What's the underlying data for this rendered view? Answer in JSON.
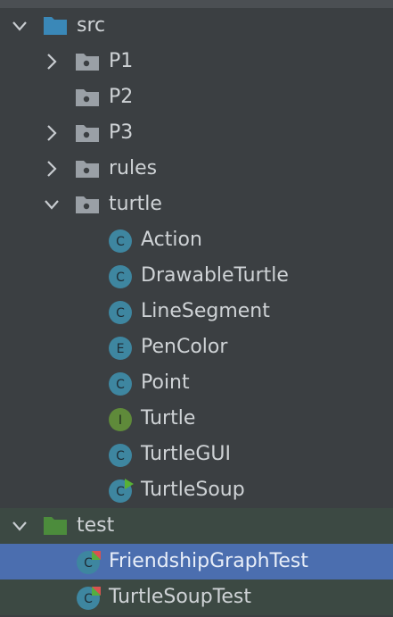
{
  "tree": {
    "src": {
      "label": "src"
    },
    "packages": [
      {
        "label": "P1"
      },
      {
        "label": "P2"
      },
      {
        "label": "P3"
      },
      {
        "label": "rules"
      },
      {
        "label": "turtle"
      }
    ],
    "turtle_items": [
      {
        "label": "Action",
        "badge": "C"
      },
      {
        "label": "DrawableTurtle",
        "badge": "C"
      },
      {
        "label": "LineSegment",
        "badge": "C"
      },
      {
        "label": "PenColor",
        "badge": "E"
      },
      {
        "label": "Point",
        "badge": "C"
      },
      {
        "label": "Turtle",
        "badge": "I"
      },
      {
        "label": "TurtleGUI",
        "badge": "C"
      },
      {
        "label": "TurtleSoup",
        "badge": "C"
      }
    ],
    "test": {
      "label": "test"
    },
    "test_items": [
      {
        "label": "FriendshipGraphTest",
        "badge": "C"
      },
      {
        "label": "TurtleSoupTest",
        "badge": "C"
      }
    ]
  },
  "colors": {
    "background": "#3b3f42",
    "selection": "#4b6eaf",
    "test_folder": "#4c8c3c",
    "source_folder": "#3a88b8",
    "class_badge": "#3e86a0",
    "interface_badge": "#5f8a3a"
  }
}
